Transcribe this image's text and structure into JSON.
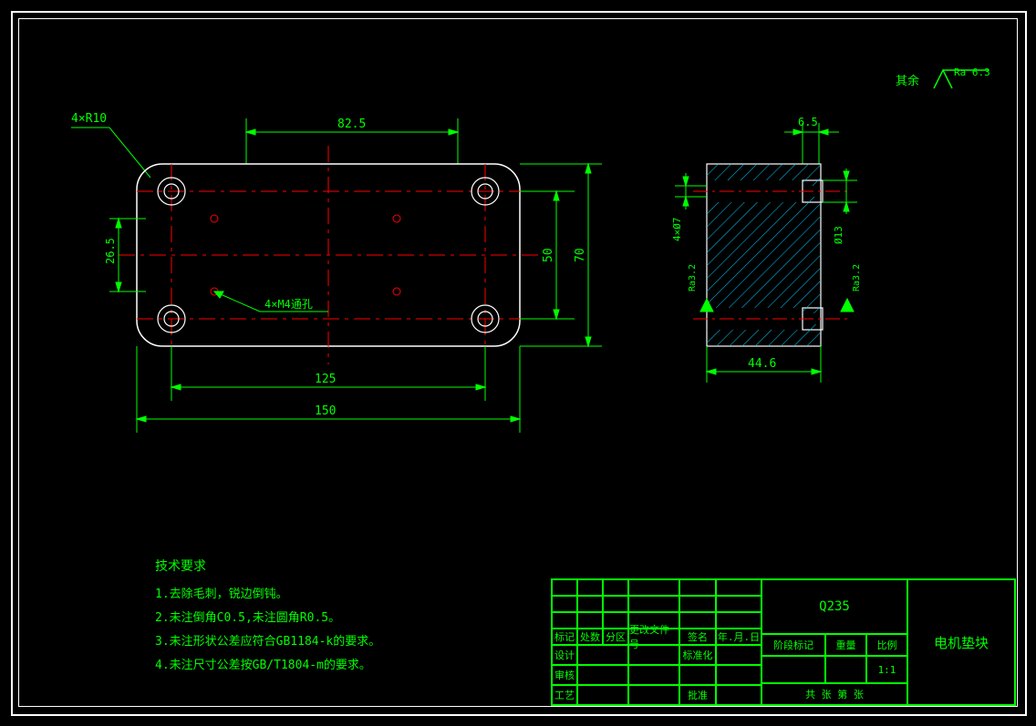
{
  "surface_finish": {
    "label": "其余",
    "value": "Ra 6.3"
  },
  "front_view": {
    "corner_radius_note": "4×R10",
    "small_holes_note": "4×M4通孔",
    "dims": {
      "d825": "82.5",
      "d125": "125",
      "d150": "150",
      "d50": "50",
      "d70": "70",
      "d265": "26.5"
    }
  },
  "side_view": {
    "dims": {
      "d65": "6.5",
      "d446": "44.6",
      "hole_dia": "4×Ø7",
      "cbore": "Ø13"
    },
    "roughness": "Ra3.2"
  },
  "tech_notes": {
    "header": "技术要求",
    "n1": "1.去除毛刺，锐边倒钝。",
    "n2": "2.未注倒角C0.5,未注圆角R0.5。",
    "n3": "3.未注形状公差应符合GB1184-k的要求。",
    "n4": "4.未注尺寸公差按GB/T1804-m的要求。"
  },
  "title_block": {
    "material": "Q235",
    "part_name": "电机垫块",
    "headers": {
      "mark": "标记",
      "qty": "处数",
      "zone": "分区",
      "chgdoc": "更改文件号",
      "sign": "签名",
      "date": "年.月.日",
      "design": "设计",
      "stdize": "标准化",
      "check": "审核",
      "process": "工艺",
      "approve": "批准",
      "stagemark": "阶段标记",
      "weight": "重量",
      "scale": "比例",
      "scale_val": "1:1",
      "sheets": "共   张  第   张"
    }
  }
}
